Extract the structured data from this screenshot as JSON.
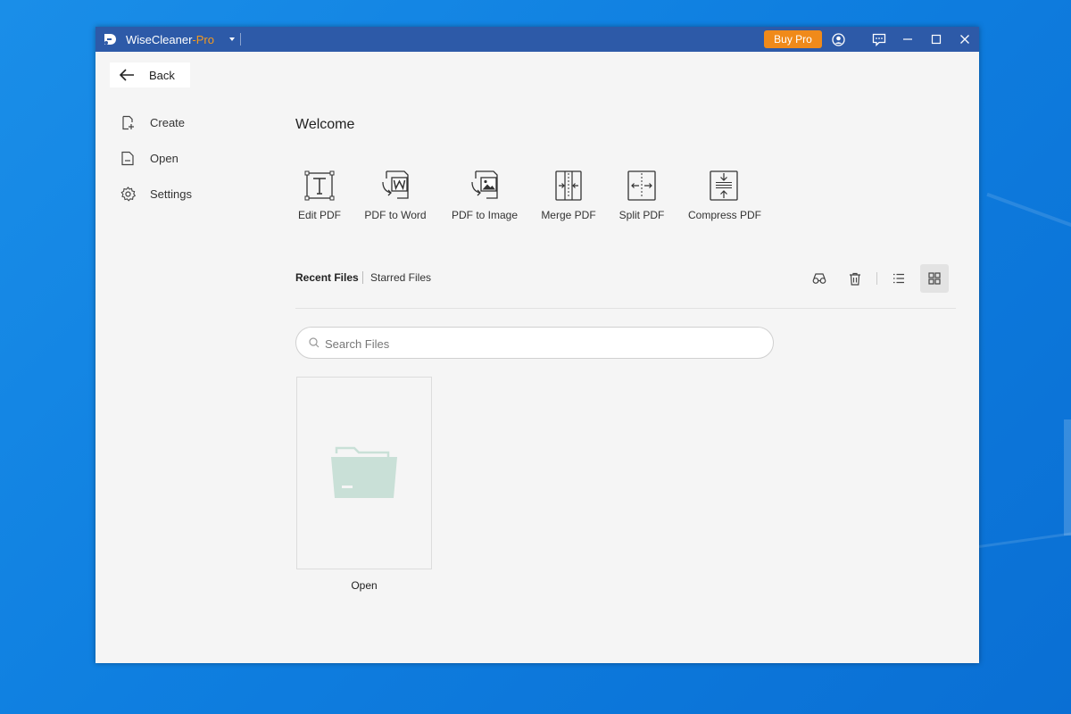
{
  "titlebar": {
    "app_name": "WiseCleaner",
    "app_suffix": "-Pro",
    "buy_pro_label": "Buy Pro"
  },
  "sidebar": {
    "back_label": "Back",
    "items": [
      {
        "label": "Create",
        "icon": "create-file-icon"
      },
      {
        "label": "Open",
        "icon": "open-file-icon"
      },
      {
        "label": "Settings",
        "icon": "gear-icon"
      }
    ]
  },
  "main": {
    "welcome": "Welcome",
    "tools": [
      {
        "label": "Edit PDF",
        "icon": "edit-text-icon"
      },
      {
        "label": "PDF to Word",
        "icon": "word-convert-icon"
      },
      {
        "label": "PDF to Image",
        "icon": "image-convert-icon"
      },
      {
        "label": "Merge PDF",
        "icon": "merge-icon"
      },
      {
        "label": "Split PDF",
        "icon": "split-icon"
      },
      {
        "label": "Compress PDF",
        "icon": "compress-icon"
      }
    ],
    "tabs": {
      "recent": "Recent Files",
      "starred": "Starred Files"
    },
    "search": {
      "placeholder": "Search Files",
      "value": ""
    },
    "files": [
      {
        "label": "Open",
        "icon": "folder-icon"
      }
    ]
  },
  "colors": {
    "titlebar": "#2d5aa8",
    "accent": "#f08a1a",
    "pro_text": "#f59a1f",
    "folder": "#c9e0d7"
  }
}
